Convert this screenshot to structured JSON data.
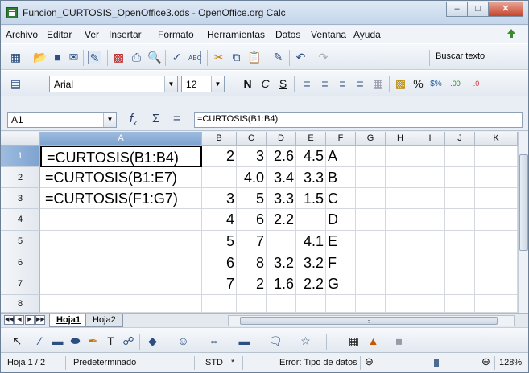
{
  "window": {
    "title": "Funcion_CURTOSIS_OpenOffice3.ods - OpenOffice.org Calc"
  },
  "menubar": {
    "items": [
      "Archivo",
      "Editar",
      "Ver",
      "Insertar",
      "Formato",
      "Herramientas",
      "Datos",
      "Ventana",
      "Ayuda"
    ]
  },
  "toolbar": {
    "search_label": "Buscar texto",
    "font_name": "Arial",
    "font_size": "12"
  },
  "formula_bar": {
    "cell_ref": "A1",
    "content": "=CURTOSIS(B1:B4)"
  },
  "columns": [
    "A",
    "B",
    "C",
    "D",
    "E",
    "F",
    "G",
    "H",
    "I",
    "J",
    "K"
  ],
  "rows": [
    "1",
    "2",
    "3",
    "4",
    "5",
    "6",
    "7",
    "8"
  ],
  "cells": {
    "A1": "=CURTOSIS(B1:B4)",
    "B1": "2",
    "C1": "3",
    "D1": "2.6",
    "E1": "4.5",
    "F1": "A",
    "A2": "=CURTOSIS(B1:E7)",
    "B2": "",
    "C2": "4.0",
    "D2": "3.4",
    "E2": "3.3",
    "F2": "B",
    "A3": "=CURTOSIS(F1:G7)",
    "B3": "3",
    "C3": "5",
    "D3": "3.3",
    "E3": "1.5",
    "F3": "C",
    "A4": "",
    "B4": "4",
    "C4": "6",
    "D4": "2.2",
    "E4": "",
    "F4": "D",
    "A5": "",
    "B5": "5",
    "C5": "7",
    "D5": "",
    "E5": "4.1",
    "F5": "E",
    "A6": "",
    "B6": "6",
    "C6": "8",
    "D6": "3.2",
    "E6": "3.2",
    "F6": "F",
    "A7": "",
    "B7": "7",
    "C7": "2",
    "D7": "1.6",
    "E7": "2.2",
    "F7": "G"
  },
  "sheet_tabs": {
    "tabs": [
      "Hoja1",
      "Hoja2"
    ],
    "active": "Hoja1"
  },
  "statusbar": {
    "sheet": "Hoja 1 / 2",
    "style": "Predeterminado",
    "mode": "STD",
    "modified": "*",
    "message": "Error: Tipo de datos",
    "zoom": "128%"
  },
  "colors": {
    "selection": "#7da3d0",
    "close_button": "#c4452c"
  }
}
